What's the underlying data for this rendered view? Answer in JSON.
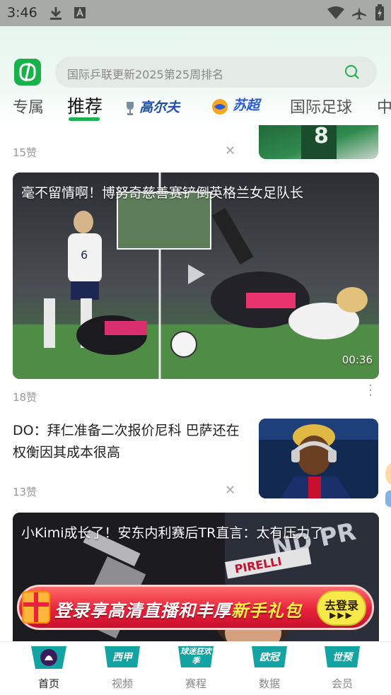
{
  "status_bar": {
    "time": "3:46",
    "icons": [
      "download-icon",
      "font-a-icon",
      "wifi-icon",
      "airplane-mode-icon",
      "battery-icon"
    ]
  },
  "header": {
    "search": {
      "placeholder": "国际乒联更新2025第25周排名",
      "icon": "search-icon"
    },
    "tabs": [
      {
        "label": "专属",
        "active": false
      },
      {
        "label": "推荐",
        "active": true
      },
      {
        "label": "高尔夫",
        "active": false,
        "style": "logo"
      },
      {
        "label": "苏超",
        "active": false,
        "style": "logo"
      },
      {
        "label": "国际足球",
        "active": false
      },
      {
        "label": "中",
        "active": false
      }
    ]
  },
  "feed": {
    "top_partial": {
      "likes": "15赞"
    },
    "video_card": {
      "title": "毫不留情啊！博努奇慈善赛铲倒英格兰女足队长",
      "duration": "00:36",
      "likes": "18赞"
    },
    "news_item": {
      "title": "DO：拜仁准备二次报价尼科 巴萨还在权衡因其成本很高",
      "likes": "13赞"
    },
    "f1_card": {
      "title": "小Kimi成长了！安东内利赛后TR直言：太有压力了"
    }
  },
  "promo_banner": {
    "text_main": "登录享高清直播和丰厚",
    "text_highlight": "新手礼包",
    "button_line1": "去登录",
    "button_line2": "▶▶▶"
  },
  "bottom_nav": {
    "items": [
      {
        "label": "首页",
        "badge": "",
        "active": true
      },
      {
        "label": "视频",
        "badge": "西甲",
        "active": false
      },
      {
        "label": "赛程",
        "badge": "球迷狂欢季",
        "active": false
      },
      {
        "label": "数据",
        "badge": "欧冠",
        "active": false
      },
      {
        "label": "会员",
        "badge": "世预",
        "active": false
      }
    ]
  },
  "colors": {
    "accent_green": "#1fb24a",
    "badge_teal": "#14a3a3",
    "promo_red": "#e8223a"
  }
}
